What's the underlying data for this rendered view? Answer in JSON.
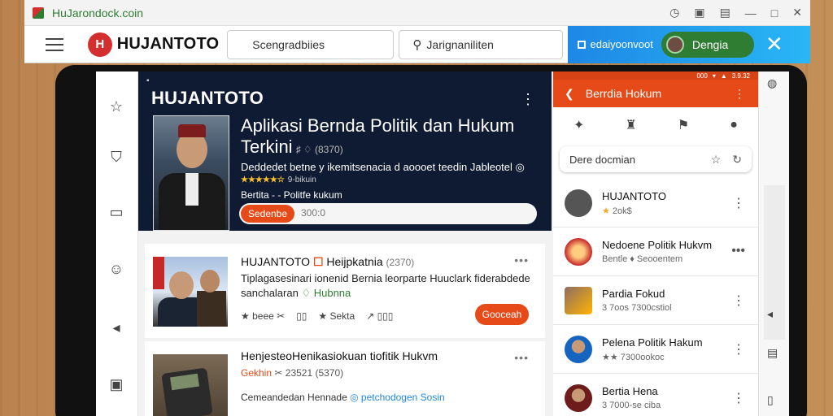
{
  "browser": {
    "tab_title": "HuJarondock.coin",
    "controls": [
      "◷",
      "▣",
      "▤",
      "—",
      "□",
      "✕"
    ]
  },
  "toolbar": {
    "logo_letter": "H",
    "logo_text": "HUJANTOTO",
    "field1": "Scengradbiies",
    "field2": "Jarignaniliten",
    "blue_label": "edaiyoonvoot",
    "pill_label": "Dengia",
    "close": "✕"
  },
  "hero": {
    "topline": "▪",
    "brand": "HUJANTOTO",
    "title": "Aplikasi Bernda Politik dan Hukum Terkini",
    "title_sub": "♯ ♢ (8370)",
    "desc": "Deddedet betne y ikemitsenacia d aoooet teedin Jableotel ◎",
    "stars": "★★★★★☆",
    "stars_text": "9-bikuin",
    "crumb": "Bertita - - Politfe kukum",
    "btn": "Sedenbe",
    "count": "300:0"
  },
  "right_panel": {
    "status": [
      "000",
      "▾",
      "▲",
      "3.9.32"
    ],
    "header_title": "Berrdia Hokum",
    "icons": [
      "✦",
      "♜",
      "⚑",
      "●"
    ],
    "search_placeholder": "Dere docmian",
    "items": [
      {
        "title": "HUJANTOTO",
        "meta": "2ok$",
        "kind": "logo"
      },
      {
        "title": "Nedoene Politik Hukvm",
        "meta": "Bentle  ♦ Seooentem",
        "kind": "badge"
      },
      {
        "title": "Pardia Fokud",
        "meta": "3 7oos 7300cstiol",
        "kind": "crowd"
      },
      {
        "title": "Pelena Politik Hakum",
        "meta": "★★ 7300ookoc",
        "kind": "person"
      },
      {
        "title": "Bertia Hena",
        "meta": "3 7000-se ciba",
        "kind": "person2"
      }
    ]
  },
  "cards": [
    {
      "headline_pre": "HUJANTOTO",
      "headline_flag": "☐",
      "headline_post": "Heijpkatnia",
      "headline_year": "(2370)",
      "body": "Tiplagasesinari ionenid Bernia leorparte Huuclark fiderabdede sanchalaran",
      "tag": "♢ Hubnna",
      "actions": [
        "★ beee ✂",
        "▯▯",
        "★ Sekta",
        "↗ ▯▯▯"
      ],
      "btn": "Gooceah"
    },
    {
      "headline": "HenjesteoHenikasiokuan tiofitik Hukvm",
      "orange": "Gekhin",
      "orange_gray": "✂ 23521 (5370)",
      "body": "Cemeandedan Hennade",
      "body_blue": "◎ petchodogen Sosin"
    }
  ]
}
